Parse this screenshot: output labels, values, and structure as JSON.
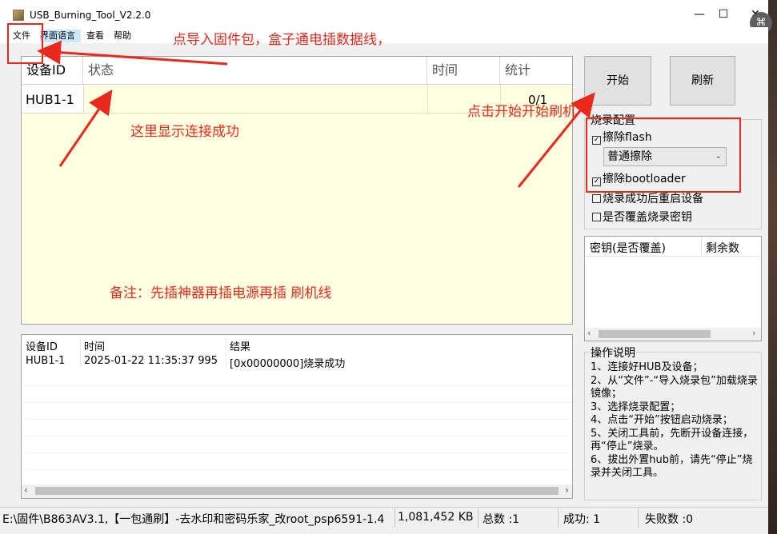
{
  "window": {
    "title": "USB_Burning_Tool_V2.2.0"
  },
  "window_controls": {
    "minimize": "—",
    "maximize": "☐",
    "close": "✕"
  },
  "menu": {
    "items": [
      "文件",
      "界面语言",
      "查看",
      "帮助"
    ]
  },
  "device_grid": {
    "columns": [
      "设备ID",
      "状态",
      "时间",
      "统计"
    ],
    "rows": [
      {
        "id": "HUB1-1",
        "status": "",
        "time": "",
        "stat": "0/1"
      }
    ]
  },
  "buttons": {
    "start": "开始",
    "refresh": "刷新"
  },
  "burn_config": {
    "title": "烧录配置",
    "erase_flash": {
      "label": "擦除flash",
      "checked": true
    },
    "erase_mode": "普通擦除",
    "erase_bootloader": {
      "label": "擦除bootloader",
      "checked": true
    },
    "reboot_after": {
      "label": "烧录成功后重启设备",
      "checked": false
    },
    "overwrite_key": {
      "label": "是否覆盖烧录密钥",
      "checked": false
    }
  },
  "key_list": {
    "col1": "密钥(是否覆盖)",
    "col2": "剩余数"
  },
  "instructions": {
    "title": "操作说明",
    "lines": [
      "1、连接好HUB及设备；",
      "2、从“文件”-“导入烧录包”加载烧录镜像；",
      "3、选择烧录配置；",
      "4、点击“开始”按钮启动烧录；",
      "5、关闭工具前，先断开设备连接，再“停止”烧录。",
      "6、拔出外置hub前，请先“停止”烧录并关闭工具。"
    ]
  },
  "log": {
    "columns": [
      "设备ID",
      "时间",
      "结果"
    ],
    "rows": [
      {
        "id": "HUB1-1",
        "time": "2025-01-22 11:35:37 995",
        "result": "[0x00000000]烧录成功"
      }
    ]
  },
  "statusbar": {
    "path": "E:\\固件\\B863AV3.1,【一包通刷】-去水印和密码乐家_改root_psp6591-1.4",
    "size": "1,081,452 KB",
    "total": "总数 :1",
    "success": "成功:  1",
    "fail": "失败数 :0"
  },
  "annotations": {
    "import": "点导入固件包，盒子通电插数据线，",
    "connected": "这里显示连接成功",
    "start": "点击开始开始刷机",
    "note": "备注：先插神器再插电源再插 刷机线"
  },
  "accent_color": "#e8291c"
}
